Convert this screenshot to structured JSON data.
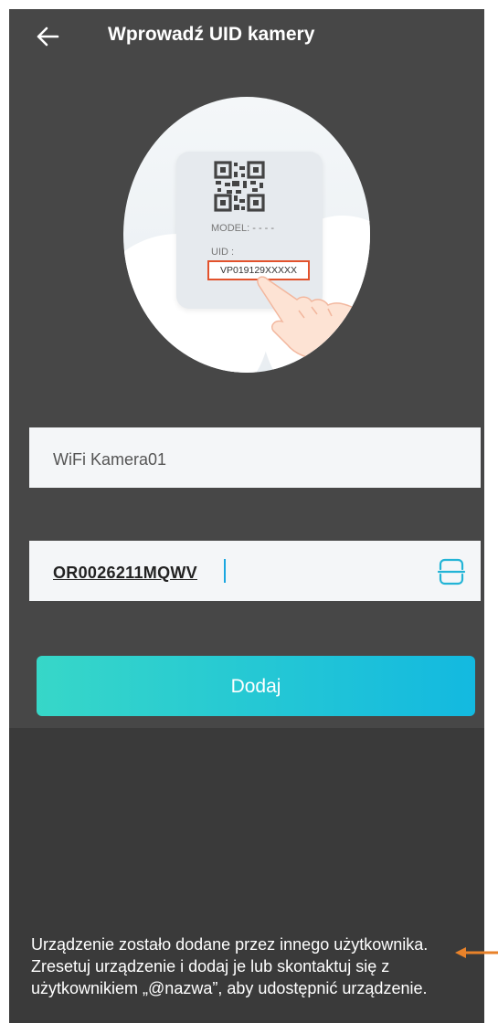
{
  "header": {
    "back_icon": "arrow-left-icon",
    "title": "Wprowadź UID kamery"
  },
  "illustration": {
    "model_label": "MODEL: - - - -",
    "uid_label": "UID :",
    "uid_example": "VP019129XXXXX",
    "highlight_color": "#e2522c"
  },
  "form": {
    "device_name_value": "WiFi Kamera01",
    "uid_value": "OR0026211MQWV",
    "scan_icon": "scan-icon",
    "add_button_label": "Dodaj"
  },
  "toast": {
    "message": "Urządzenie zostało dodane przez innego użytkownika. Zresetuj urządzenie i dodaj je lub skontaktuj się z użytkownikiem „@nazwa”, aby udostępnić urządzenie."
  },
  "colors": {
    "background": "#474747",
    "accent_start": "#37d7c8",
    "accent_end": "#13b9e0",
    "annotation_arrow": "#e8822a"
  }
}
